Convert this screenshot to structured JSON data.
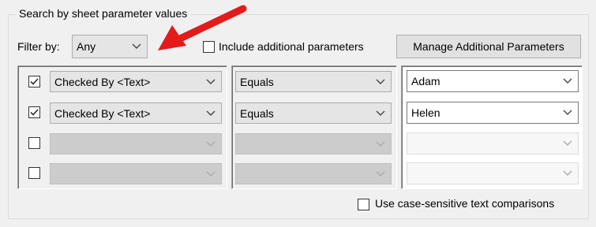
{
  "group_title": "Search by sheet parameter values",
  "filter": {
    "label": "Filter by:",
    "value": "Any"
  },
  "include_additional": {
    "label": "Include additional parameters",
    "checked": false
  },
  "manage_button": {
    "label": "Manage Additional Parameters"
  },
  "rows": [
    {
      "checked": true,
      "parameter": "Checked By <Text>",
      "operator": "Equals",
      "value": "Adam",
      "enabled": true
    },
    {
      "checked": true,
      "parameter": "Checked By <Text>",
      "operator": "Equals",
      "value": "Helen",
      "enabled": true
    },
    {
      "checked": false,
      "parameter": "",
      "operator": "",
      "value": "",
      "enabled": false
    },
    {
      "checked": false,
      "parameter": "",
      "operator": "",
      "value": "",
      "enabled": false
    }
  ],
  "case_sensitive": {
    "label": "Use case-sensitive text comparisons",
    "checked": false
  },
  "colors": {
    "arrow": "#e31b1b",
    "chevron": "#444444",
    "chevron_disabled": "#aaaaaa"
  },
  "icons": {
    "dropdown": "chevron-down-icon",
    "annotation": "red-arrow-icon",
    "check": "checkmark-icon"
  }
}
